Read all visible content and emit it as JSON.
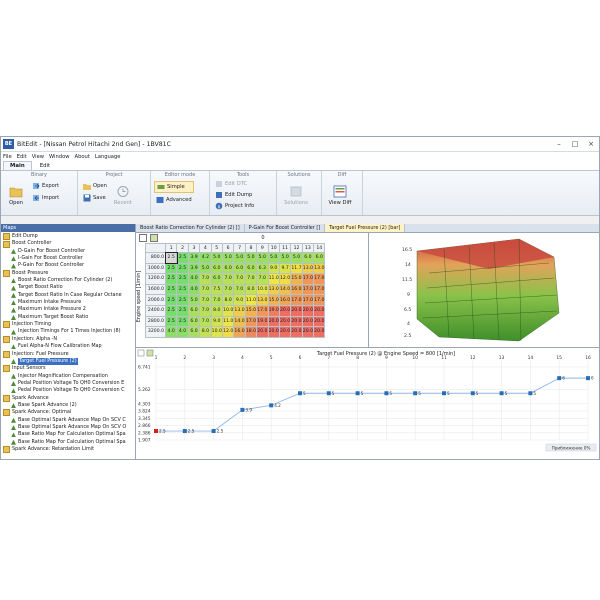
{
  "window": {
    "title": "BitEdit - [Nissan Petrol Hitachi 2nd Gen] - 1BV81C",
    "logo": "BE",
    "controls": [
      "–",
      "□",
      "×"
    ]
  },
  "menu": [
    "File",
    "Edit",
    "View",
    "Window",
    "About",
    "Language"
  ],
  "ribbon_tabs": [
    "Main",
    "Edit"
  ],
  "ribbon": {
    "binary": {
      "title": "Binary",
      "open": "Open",
      "export": "Export",
      "import": "Import"
    },
    "project": {
      "title": "Project",
      "open": "Open",
      "save": "Save",
      "recent": "Recent"
    },
    "editor_mode": {
      "title": "Editor mode",
      "simple": "Simple",
      "advanced": "Advanced"
    },
    "tools": {
      "title": "Tools",
      "edit_dtc": "Edit DTC",
      "edit_dump": "Edit Dump",
      "project_info": "Project Info"
    },
    "solutions": {
      "title": "Solutions",
      "solutions": "Solutions"
    },
    "diff": {
      "title": "Diff",
      "view_diff": "View Diff"
    }
  },
  "maps_panel": {
    "title": "Maps",
    "items": [
      {
        "label": "Edit Dump",
        "type": "folder",
        "level": 0
      },
      {
        "label": "Boost Controller",
        "type": "folder",
        "level": 0
      },
      {
        "label": "D-Gain For Boost Controller",
        "type": "map",
        "level": 1
      },
      {
        "label": "I-Gain For Boost Controller",
        "type": "map",
        "level": 1
      },
      {
        "label": "P-Gain For Boost Controller",
        "type": "map",
        "level": 1
      },
      {
        "label": "Boost Pressure",
        "type": "folder",
        "level": 0
      },
      {
        "label": "Boost Ratio Correction For Cylinder (2)",
        "type": "map",
        "level": 1
      },
      {
        "label": "Target Boost Ratio",
        "type": "map",
        "level": 1
      },
      {
        "label": "Target Boost Ratio In Case Regular Octane",
        "type": "map",
        "level": 1
      },
      {
        "label": "Maximum Intake Pressure",
        "type": "map",
        "level": 1
      },
      {
        "label": "Maximum Intake Pressure 2",
        "type": "map",
        "level": 1
      },
      {
        "label": "Maximum Target Boost Ratio",
        "type": "map",
        "level": 1
      },
      {
        "label": "Injection Timing",
        "type": "folder",
        "level": 0
      },
      {
        "label": "Injection Timings For 1 Times Injection (8)",
        "type": "map",
        "level": 1
      },
      {
        "label": "Injection: Alpha -N",
        "type": "folder",
        "level": 0
      },
      {
        "label": "Fuel Alpha-N Flow Calibration Map",
        "type": "map",
        "level": 1
      },
      {
        "label": "Injection: Fuel Pressure",
        "type": "folder",
        "level": 0
      },
      {
        "label": "Target Fuel Pressure (2)",
        "type": "map",
        "level": 1,
        "selected": true
      },
      {
        "label": "Input Sensors",
        "type": "folder",
        "level": 0
      },
      {
        "label": "Injector Magnification Compensation",
        "type": "map",
        "level": 1
      },
      {
        "label": "Pedal Position Voltage To QH0 Conversion E",
        "type": "map",
        "level": 1
      },
      {
        "label": "Pedal Position Voltage To QH0 Conversion C",
        "type": "map",
        "level": 1
      },
      {
        "label": "Spark Advance",
        "type": "folder",
        "level": 0
      },
      {
        "label": "Base Spark Advance (2)",
        "type": "map",
        "level": 1
      },
      {
        "label": "Spark Advance: Optimal",
        "type": "folder",
        "level": 0
      },
      {
        "label": "Base Optimal Spark Advance Map On SCV C",
        "type": "map",
        "level": 1
      },
      {
        "label": "Base Optimal Spark Advance Map On SCV O",
        "type": "map",
        "level": 1
      },
      {
        "label": "Base Ratio Map For Calculation Optimal Spa",
        "type": "map",
        "level": 1
      },
      {
        "label": "Base Ratio Map For Calculation Optimal Spa",
        "type": "map",
        "level": 1
      },
      {
        "label": "Spark Advance: Retardation Limit",
        "type": "folder",
        "level": 0
      }
    ]
  },
  "doc_tabs": [
    {
      "label": "Boost Ratio Correction For Cylinder (2) []"
    },
    {
      "label": "P-Gain For Boost Controller []"
    },
    {
      "label": "Target Fuel Pressure (2) [bar]",
      "active": true
    }
  ],
  "map_grid": {
    "top_axis_value": "0",
    "row_axis_label": "Engine speed [1/min]",
    "columns": [
      "1",
      "2",
      "3",
      "4",
      "5",
      "6",
      "7",
      "8",
      "9",
      "10",
      "11",
      "12",
      "13",
      "14"
    ],
    "rows": [
      {
        "label": "800.0",
        "values": [
          "2.5",
          "2.5",
          "3.9",
          "4.2",
          "5.0",
          "5.0",
          "5.0",
          "5.0",
          "5.0",
          "5.0",
          "5.0",
          "5.0",
          "6.0",
          "6.0"
        ]
      },
      {
        "label": "1000.0",
        "values": [
          "2.5",
          "2.5",
          "3.9",
          "5.0",
          "6.0",
          "6.0",
          "6.0",
          "6.0",
          "6.3",
          "9.0",
          "9.7",
          "11.7",
          "13.0",
          "13.0"
        ]
      },
      {
        "label": "1200.0",
        "values": [
          "2.5",
          "2.5",
          "4.0",
          "7.0",
          "6.0",
          "7.0",
          "7.0",
          "7.0",
          "7.0",
          "11.0",
          "12.0",
          "15.0",
          "17.0",
          "17.0"
        ]
      },
      {
        "label": "1600.0",
        "values": [
          "2.5",
          "2.5",
          "4.0",
          "7.0",
          "7.5",
          "7.0",
          "7.0",
          "8.0",
          "10.0",
          "13.0",
          "14.0",
          "16.0",
          "17.0",
          "17.0"
        ]
      },
      {
        "label": "2000.0",
        "values": [
          "2.5",
          "2.5",
          "5.0",
          "7.0",
          "7.0",
          "8.0",
          "9.0",
          "11.0",
          "13.0",
          "15.0",
          "16.0",
          "17.0",
          "17.0",
          "17.0"
        ]
      },
      {
        "label": "2400.0",
        "values": [
          "2.5",
          "2.5",
          "6.0",
          "7.0",
          "8.0",
          "10.0",
          "13.0",
          "15.0",
          "17.0",
          "19.0",
          "20.0",
          "20.0",
          "20.0",
          "20.0"
        ]
      },
      {
        "label": "2800.0",
        "values": [
          "2.5",
          "2.5",
          "6.0",
          "7.0",
          "9.0",
          "11.0",
          "14.0",
          "17.0",
          "19.0",
          "20.0",
          "20.0",
          "20.0",
          "20.0",
          "20.0"
        ]
      },
      {
        "label": "3200.0",
        "values": [
          "4.0",
          "4.0",
          "6.0",
          "8.0",
          "10.0",
          "12.0",
          "16.0",
          "18.0",
          "20.0",
          "20.0",
          "20.0",
          "20.0",
          "20.0",
          "20.0"
        ]
      }
    ]
  },
  "surface_axis_ticks": [
    "16.5",
    "14",
    "11.5",
    "9",
    "6.5",
    "4",
    "2.5"
  ],
  "chart_data": {
    "type": "line",
    "title": "Target Fuel Pressure (2) @ Engine Speed = 800 [1/min]",
    "x": [
      1,
      2,
      3,
      4,
      5,
      6,
      7,
      8,
      9,
      10,
      11,
      12,
      13,
      14,
      15,
      16
    ],
    "y": [
      2.5,
      2.5,
      2.5,
      3.9,
      4.2,
      5,
      5,
      5,
      5,
      5,
      5,
      5,
      5,
      5,
      6,
      6
    ],
    "point_labels": [
      "2.5",
      "2.5",
      "2.5",
      "3.9",
      "4.2",
      "5",
      "5",
      "5",
      "5",
      "5",
      "5",
      "5",
      "5",
      "5",
      "6",
      "6"
    ],
    "x_ticks": [
      "1",
      "2",
      "3",
      "4",
      "5",
      "6",
      "7",
      "8",
      "9",
      "10",
      "11",
      "12",
      "13",
      "14",
      "15",
      "16"
    ],
    "y_ticks": [
      "6.741",
      "5.262",
      "4.303",
      "3.824",
      "3.345",
      "2.866",
      "2.386",
      "1.907"
    ],
    "ylim": [
      1.907,
      7.2
    ],
    "grid": true,
    "zoom_label": "Приближение 0%",
    "colors": {
      "selected_point": "#d8201a",
      "point": "#2a6db5",
      "line": "#8fb7e6"
    }
  }
}
